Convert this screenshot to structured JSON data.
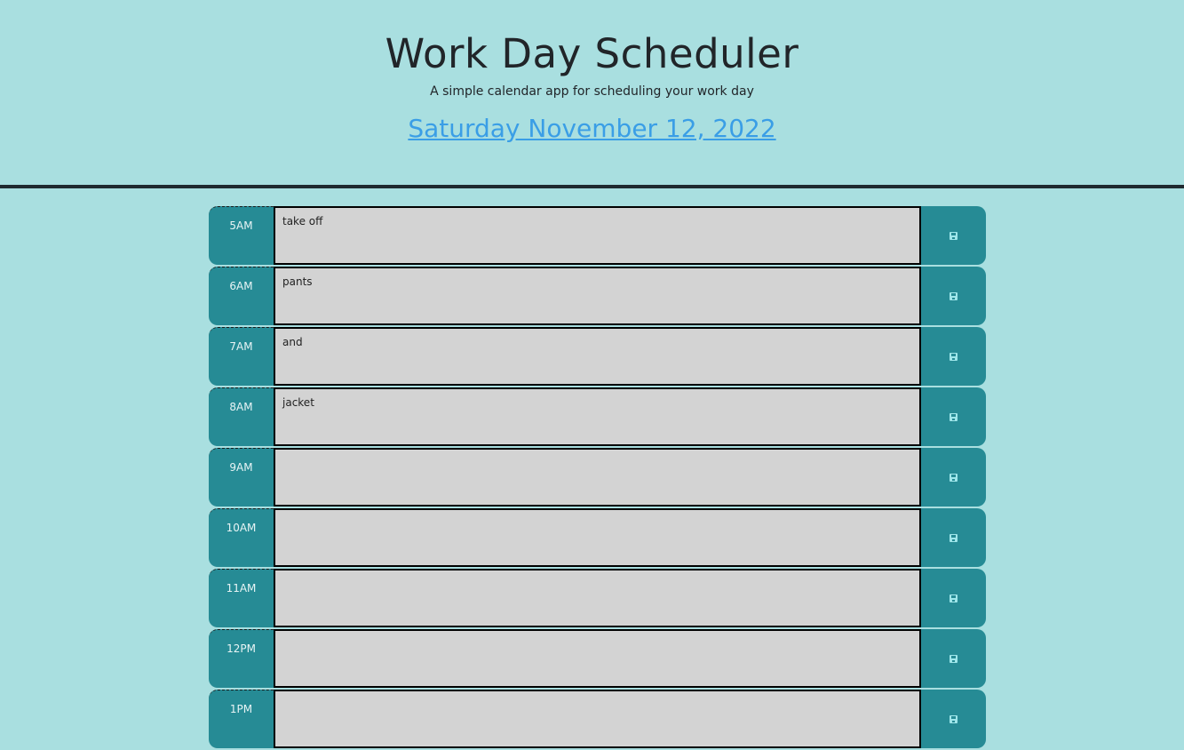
{
  "header": {
    "title": "Work Day Scheduler",
    "subtitle": "A simple calendar app for scheduling your work day",
    "current_day": "Saturday November 12, 2022"
  },
  "colors": {
    "background": "#a9dfe0",
    "block": "#268b95",
    "textarea": "#d3d3d3",
    "date_link": "#3a9ee6"
  },
  "time_blocks": [
    {
      "hour": "5AM",
      "text": "take off",
      "save_icon": "floppy-disk-icon"
    },
    {
      "hour": "6AM",
      "text": "pants",
      "save_icon": "floppy-disk-icon"
    },
    {
      "hour": "7AM",
      "text": "and",
      "save_icon": "floppy-disk-icon"
    },
    {
      "hour": "8AM",
      "text": "jacket",
      "save_icon": "floppy-disk-icon"
    },
    {
      "hour": "9AM",
      "text": "",
      "save_icon": "floppy-disk-icon"
    },
    {
      "hour": "10AM",
      "text": "",
      "save_icon": "floppy-disk-icon"
    },
    {
      "hour": "11AM",
      "text": "",
      "save_icon": "floppy-disk-icon"
    },
    {
      "hour": "12PM",
      "text": "",
      "save_icon": "floppy-disk-icon"
    },
    {
      "hour": "1PM",
      "text": "",
      "save_icon": "floppy-disk-icon"
    }
  ]
}
